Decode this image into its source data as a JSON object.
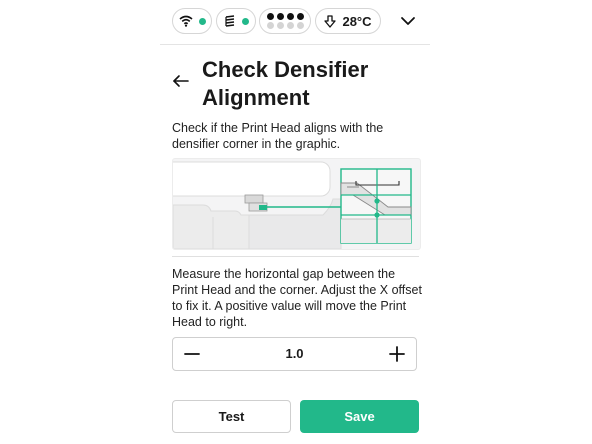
{
  "status_bar": {
    "wifi_icon": "wifi-icon",
    "wifi_dot_color": "#22b88a",
    "material_icon": "material-stack-icon",
    "material_dot_color": "#22b88a",
    "extruder_dots": [
      "#111111",
      "#111111",
      "#111111",
      "#111111"
    ],
    "temperature_icon": "cooling-arrow-icon",
    "temperature": "28°C",
    "expand_icon": "chevron-down-icon"
  },
  "header": {
    "back_icon": "back-arrow-icon",
    "title": "Check Densifier Alignment"
  },
  "instruction_1": "Check if the Print Head aligns with the densifier corner in the graphic.",
  "instruction_2": "Measure the horizontal gap between the Print Head and the corner. Adjust the X offset to fix it. A positive value will move the Print Head to right.",
  "stepper": {
    "minus_icon": "minus-icon",
    "plus_icon": "plus-icon",
    "value": "1.0"
  },
  "actions": {
    "test_label": "Test",
    "save_label": "Save"
  },
  "colors": {
    "accent": "#22b88a",
    "border": "#d6d6d6"
  }
}
